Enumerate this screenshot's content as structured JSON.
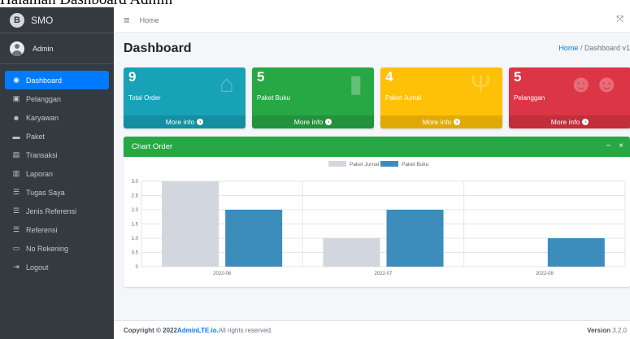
{
  "caption": "Halaman Dashboard Admin",
  "sidebar": {
    "brand": "SMO",
    "brand_logo": "B",
    "user": "Admin",
    "items": [
      {
        "label": "Dashboard",
        "icon": "tachometer-icon",
        "glyph": "◉",
        "active": true
      },
      {
        "label": "Pelanggan",
        "icon": "user-card-icon",
        "glyph": "▣",
        "active": false
      },
      {
        "label": "Karyawan",
        "icon": "users-icon",
        "glyph": "☻",
        "active": false
      },
      {
        "label": "Paket",
        "icon": "box-icon",
        "glyph": "▬",
        "active": false
      },
      {
        "label": "Transaksi",
        "icon": "invoice-icon",
        "glyph": "▤",
        "active": false
      },
      {
        "label": "Laporan",
        "icon": "chart-icon",
        "glyph": "▥",
        "active": false
      },
      {
        "label": "Tugas Saya",
        "icon": "tasks-icon",
        "glyph": "☰",
        "active": false
      },
      {
        "label": "Jenis Referensi",
        "icon": "list-icon",
        "glyph": "☰",
        "active": false
      },
      {
        "label": "Referensi",
        "icon": "list-icon",
        "glyph": "☰",
        "active": false
      },
      {
        "label": "No Rekening",
        "icon": "credit-card-icon",
        "glyph": "▭",
        "active": false
      },
      {
        "label": "Logout",
        "icon": "sign-out-icon",
        "glyph": "⇥",
        "active": false
      }
    ]
  },
  "topbar": {
    "home": "Home",
    "menu_icon": "≡",
    "expand_icon": "⤧"
  },
  "content": {
    "title": "Dashboard",
    "breadcrumb_home": "Home",
    "breadcrumb_sep": " / ",
    "breadcrumb_current": "Dashboard v1"
  },
  "boxes": [
    {
      "value": "9",
      "label": "Total Order",
      "footer": "More info",
      "color": "#17a2b8",
      "icon": "shopping-bag-icon",
      "glyph": "⌂"
    },
    {
      "value": "5",
      "label": "Paket Buku",
      "footer": "More info",
      "color": "#28a745",
      "icon": "book-icon",
      "glyph": "▮"
    },
    {
      "value": "4",
      "label": "Paket Jurnal",
      "footer": "More info",
      "color": "#ffc107",
      "icon": "journal-icon",
      "glyph": "Ψ"
    },
    {
      "value": "5",
      "label": "Pelanggan",
      "footer": "More info",
      "color": "#dc3545",
      "icon": "users-icon",
      "glyph": "☻☻"
    }
  ],
  "card": {
    "title": "Chart Order",
    "collapse": "−",
    "close": "×"
  },
  "chart_data": {
    "type": "bar",
    "categories": [
      "2022-06",
      "2022-07",
      "2022-08"
    ],
    "series": [
      {
        "name": "Paket Jurnal",
        "values": [
          3,
          1,
          0
        ],
        "color": "#d2d6de"
      },
      {
        "name": "Paket Buku",
        "values": [
          2,
          2,
          1
        ],
        "color": "#3c8dbc"
      }
    ],
    "ylim": [
      0,
      3
    ],
    "yticks": [
      "0",
      "0.5",
      "1.0",
      "1.5",
      "2.0",
      "2.5",
      "3.0"
    ],
    "grid": true,
    "legend": "top-center"
  },
  "footer": {
    "copyright": "Copyright © 2022 ",
    "brand": "AdminLTE.io.",
    "rights": " All rights reserved.",
    "version_label": "Version",
    "version": " 3.2.0"
  }
}
